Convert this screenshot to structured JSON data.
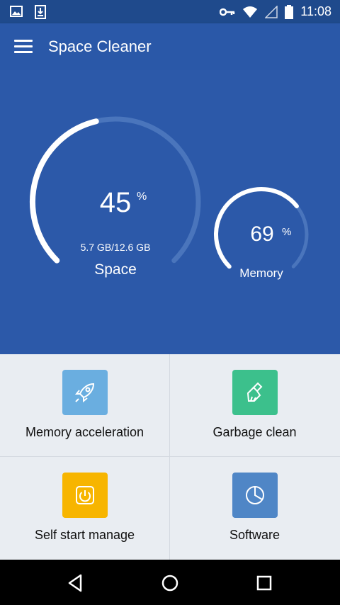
{
  "status_bar": {
    "time": "11:08",
    "icons": [
      "image-icon",
      "download-icon",
      "key-icon",
      "wifi-icon",
      "signal-icon",
      "battery-icon"
    ]
  },
  "app_bar": {
    "title": "Space Cleaner",
    "menu_icon": "menu-icon"
  },
  "space_gauge": {
    "percent": "45",
    "percent_sign": "%",
    "percent_value": 0.45,
    "usage": "5.7 GB/12.6 GB",
    "label": "Space"
  },
  "memory_gauge": {
    "percent": "69",
    "percent_sign": "%",
    "percent_value": 0.69,
    "label": "Memory"
  },
  "features": [
    {
      "label": "Memory acceleration",
      "icon": "rocket-icon",
      "color": "#6aaee0"
    },
    {
      "label": "Garbage clean",
      "icon": "broom-icon",
      "color": "#3cc08c"
    },
    {
      "label": "Self start manage",
      "icon": "power-icon",
      "color": "#f7b500"
    },
    {
      "label": "Software",
      "icon": "pie-chart-icon",
      "color": "#4f86c6"
    }
  ],
  "nav_bar": {
    "back": "back-icon",
    "home": "home-icon",
    "recents": "recents-icon"
  },
  "colors": {
    "status_bar": "#1f4a8c",
    "app_bar": "#2a58a8",
    "hero": "#2c59a9",
    "track": "#4a75bc",
    "progress": "#ffffff"
  }
}
